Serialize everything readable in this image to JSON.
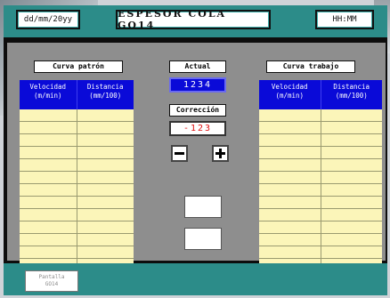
{
  "header": {
    "date": "dd/mm/20yy",
    "title": "ESPESOR COLA GO14",
    "time": "HH:MM"
  },
  "left_table": {
    "title": "Curva patrón",
    "col1": "Velocidad\n(m/min)",
    "col2": "Distancia\n(mm/100)",
    "rows": 13
  },
  "right_table": {
    "title": "Curva trabajo",
    "col1": "Velocidad\n(m/min)",
    "col2": "Distancia\n(mm/100)",
    "rows": 13
  },
  "center": {
    "actual_label": "Actual",
    "actual_value": "1234",
    "correction_label": "Corrección",
    "correction_value": "-123",
    "minus_icon": "minus-icon",
    "plus_icon": "plus-icon"
  },
  "footer": {
    "screen_button": "Pantalla\nGO14"
  },
  "colors": {
    "header_teal": "#2c8c89",
    "table_header_blue": "#0a0ad8",
    "table_body_yellow": "#fbf5b9",
    "correction_red": "#e01010"
  }
}
